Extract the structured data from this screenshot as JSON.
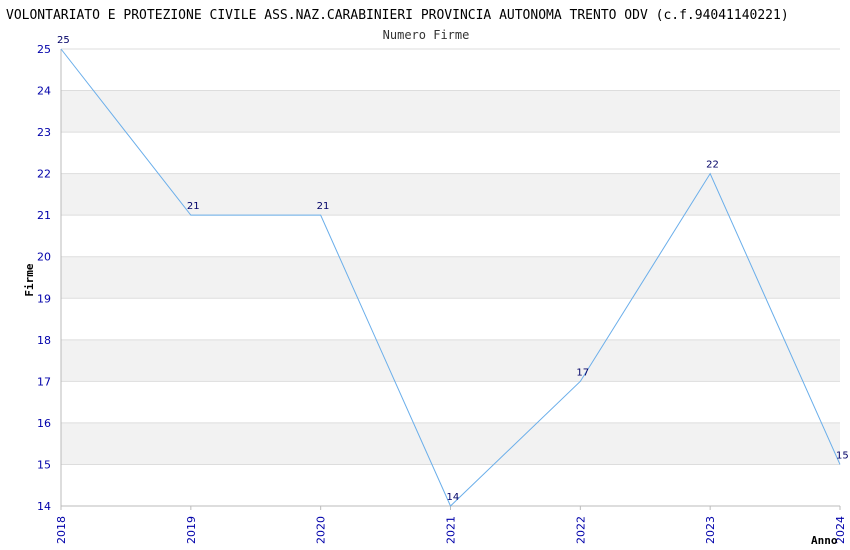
{
  "chart_data": {
    "type": "line",
    "title": "VOLONTARIATO E PROTEZIONE CIVILE ASS.NAZ.CARABINIERI PROVINCIA AUTONOMA TRENTO ODV (c.f.94041140221)",
    "subtitle": "Numero Firme",
    "xlabel": "Anno",
    "ylabel": "Firme",
    "categories": [
      "2018",
      "2019",
      "2020",
      "2021",
      "2022",
      "2023",
      "2024"
    ],
    "values": [
      25,
      21,
      21,
      14,
      17,
      22,
      15
    ],
    "ylim": [
      14,
      25
    ],
    "yticks": [
      "14",
      "15",
      "16",
      "17",
      "18",
      "19",
      "20",
      "21",
      "22",
      "23",
      "24",
      "25"
    ],
    "grid": "horizontal alternating bands",
    "colors": {
      "line": "#6aaeea",
      "band": "#f2f2f2",
      "grid": "#dddddd",
      "tick_text": "#0000aa",
      "label_text": "#000066"
    }
  }
}
